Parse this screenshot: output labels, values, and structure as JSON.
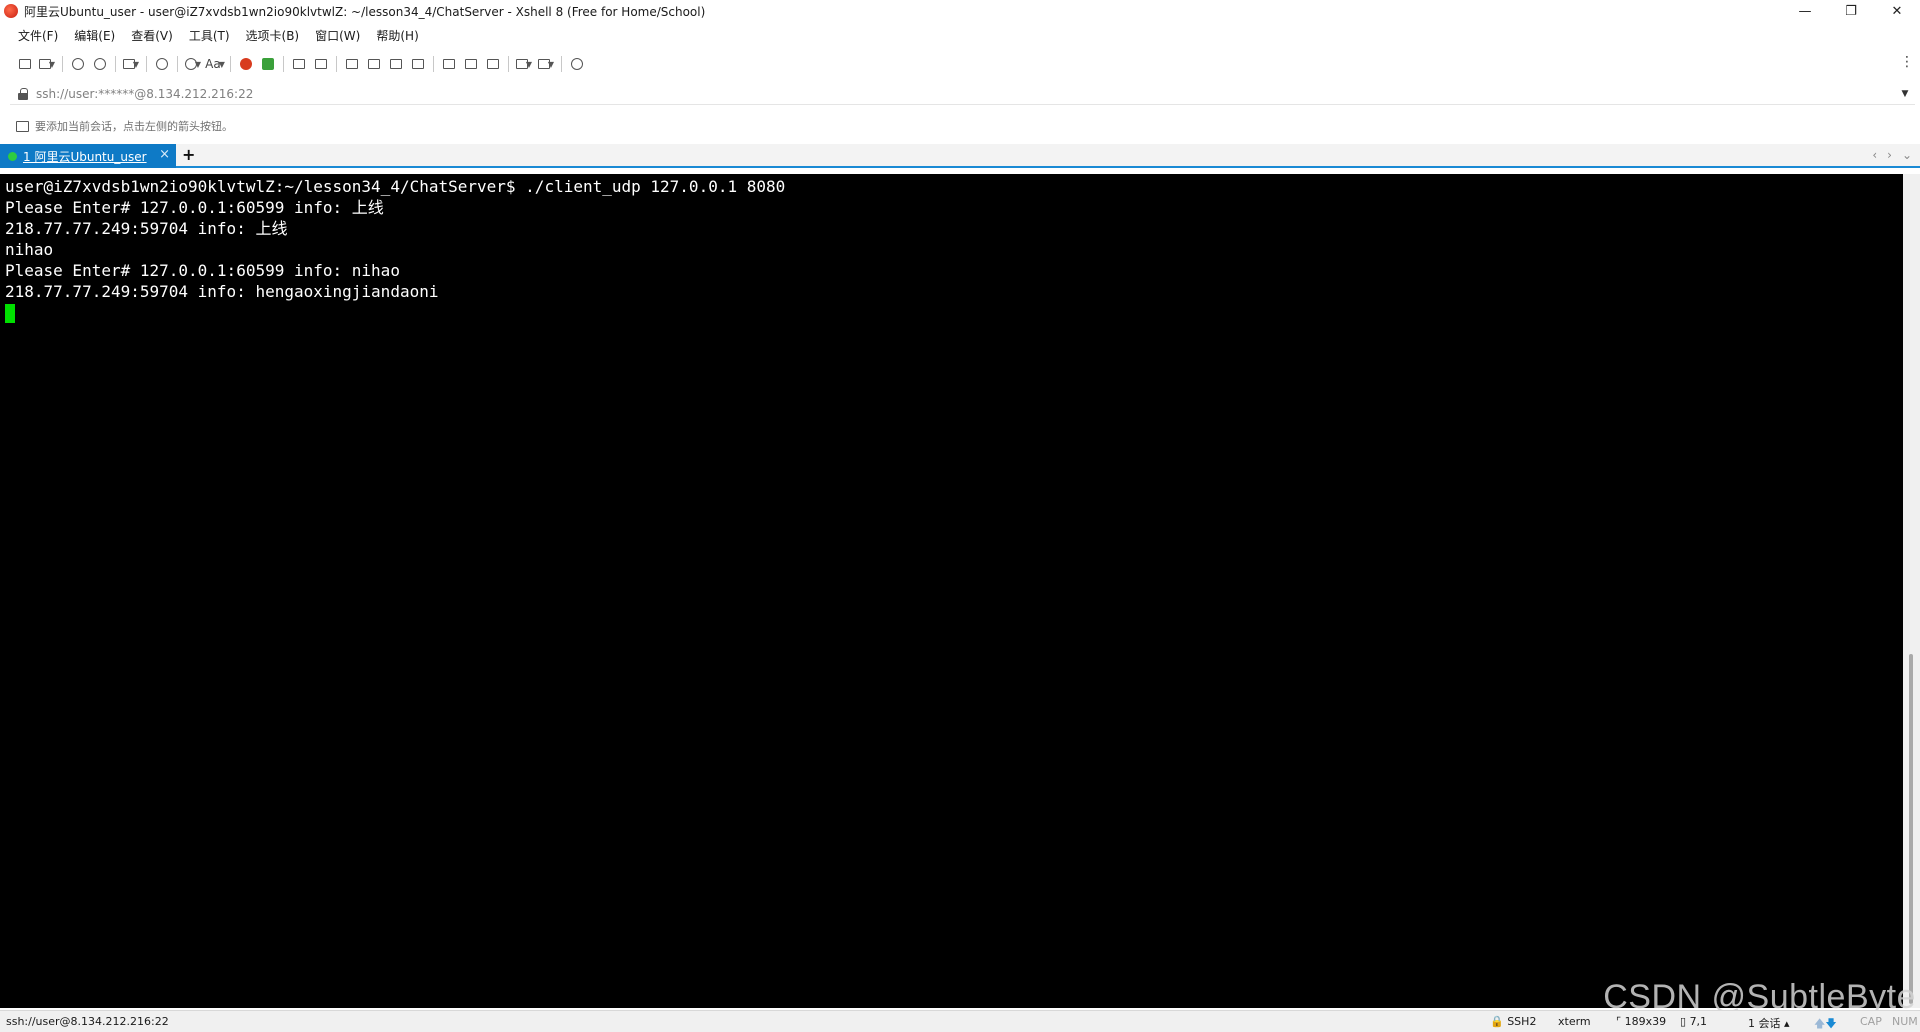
{
  "window": {
    "title": "阿里云Ubuntu_user - user@iZ7xvdsb1wn2io90klvtwlZ: ~/lesson34_4/ChatServer - Xshell 8 (Free for Home/School)",
    "minimize_glyph": "—",
    "maximize_glyph": "❐",
    "close_glyph": "✕"
  },
  "menu": {
    "items": [
      "文件(F)",
      "编辑(E)",
      "查看(V)",
      "工具(T)",
      "选项卡(B)",
      "窗口(W)",
      "帮助(H)"
    ]
  },
  "toolbar": {
    "font_label": "Aa",
    "more_glyph": "⋮"
  },
  "address": {
    "value": "ssh://user:******@8.134.212.216:22",
    "dropdown_glyph": "▼"
  },
  "hint": {
    "text": "要添加当前会话，点击左侧的箭头按钮。"
  },
  "tabs": {
    "active_label": "1 阿里云Ubuntu_user",
    "close_glyph": "×",
    "add_glyph": "+",
    "nav_left": "‹",
    "nav_right": "›",
    "nav_menu": "⌄"
  },
  "terminal": {
    "lines": [
      "user@iZ7xvdsb1wn2io90klvtwlZ:~/lesson34_4/ChatServer$ ./client_udp 127.0.0.1 8080",
      "Please Enter# 127.0.0.1:60599 info: 上线",
      "218.77.77.249:59704 info: 上线",
      "nihao",
      "Please Enter# 127.0.0.1:60599 info: nihao",
      "218.77.77.249:59704 info: hengaoxingjiandaoni"
    ]
  },
  "watermark": "CSDN @SubtleByte",
  "status": {
    "connection": "ssh://user@8.134.212.216:22",
    "protocol": "SSH2",
    "terminal_type": "xterm",
    "size": "189x39",
    "cursor_pos": "7,1",
    "sessions": "1 会话",
    "cap": "CAP",
    "num": "NUM"
  },
  "colors": {
    "tab_active": "#0e7ac6",
    "terminal_bg": "#000000",
    "cursor": "#00e000",
    "watermark": "#d2d2d2"
  }
}
